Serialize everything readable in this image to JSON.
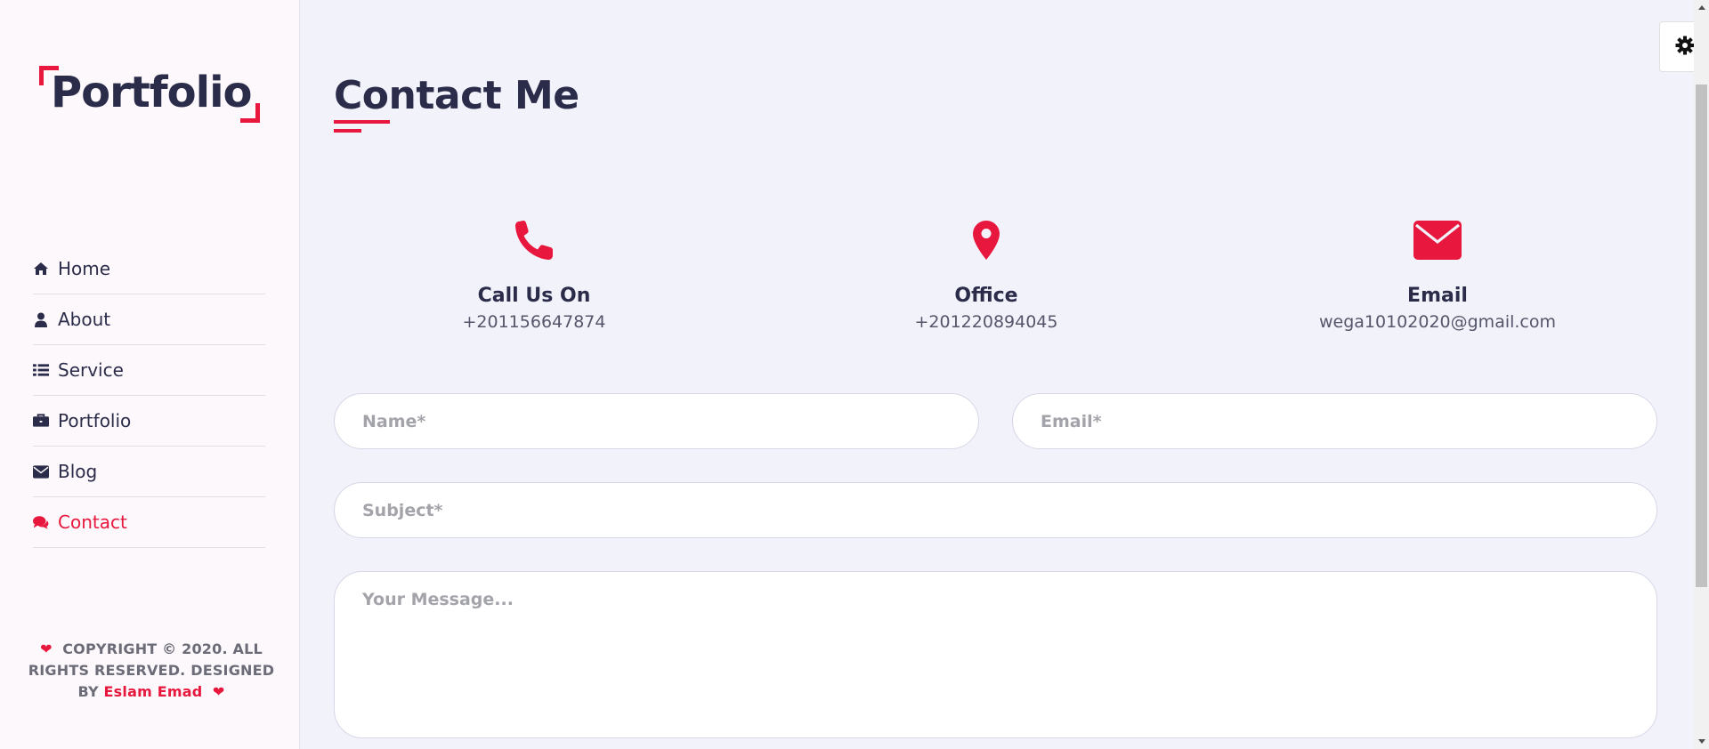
{
  "sidebar": {
    "logo": "Portfolio",
    "items": [
      {
        "label": "Home",
        "icon": "home-icon",
        "active": false
      },
      {
        "label": "About",
        "icon": "user-icon",
        "active": false
      },
      {
        "label": "Service",
        "icon": "list-icon",
        "active": false
      },
      {
        "label": "Portfolio",
        "icon": "briefcase-icon",
        "active": false
      },
      {
        "label": "Blog",
        "icon": "envelope-icon",
        "active": false
      },
      {
        "label": "Contact",
        "icon": "comments-icon",
        "active": true
      }
    ],
    "copyright_prefix": "COPYRIGHT © 2020. ALL RIGHTS RESERVED. DESIGNED BY",
    "author": "Eslam Emad"
  },
  "main": {
    "title": "Contact Me",
    "info": [
      {
        "title": "Call Us On",
        "value": "+201156647874",
        "icon": "phone-icon"
      },
      {
        "title": "Office",
        "value": "+201220894045",
        "icon": "map-marker-icon"
      },
      {
        "title": "Email",
        "value": "wega10102020@gmail.com",
        "icon": "envelope-icon"
      }
    ],
    "form": {
      "name_placeholder": "Name*",
      "email_placeholder": "Email*",
      "subject_placeholder": "Subject*",
      "message_placeholder": "Your Message..."
    }
  },
  "colors": {
    "accent": "#e8173d",
    "text_dark": "#2b2c4a",
    "background": "#f2f2fb",
    "sidebar_bg": "#fcf8fc"
  }
}
